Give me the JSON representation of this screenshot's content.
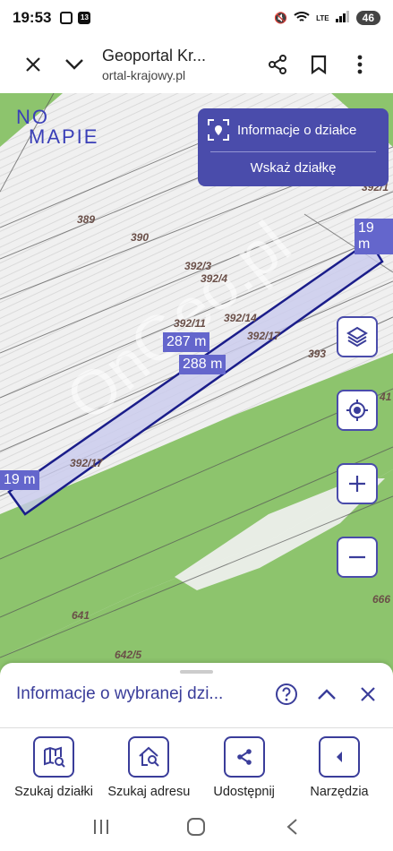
{
  "status": {
    "time": "19:53",
    "badge": "13",
    "network": "LTE",
    "battery": "46"
  },
  "browser": {
    "title": "Geoportal Kr...",
    "url": "ortal-krajowy.pl"
  },
  "map": {
    "logo_top": "NO",
    "logo_bottom": "MAPIE",
    "info_title": "Informacje o działce",
    "info_action": "Wskaż działkę",
    "measurements": [
      "19 m",
      "287 m",
      "288 m",
      "19 m"
    ],
    "parcels": [
      "389",
      "390",
      "392/3",
      "392/4",
      "392/11",
      "392/14",
      "392/17",
      "393",
      "392/17",
      "392/1",
      "641",
      "642/5",
      "666",
      "41"
    ],
    "watermark": "OnGeo.pl",
    "colors": {
      "field": "#8dc46d",
      "parcel_fill": "#cdcff0",
      "parcel_stroke": "#1a1d8a",
      "accent": "#4a4cab"
    }
  },
  "sheet": {
    "title": "Informacje o wybranej dzi..."
  },
  "actions": [
    {
      "label": "Szukaj działki"
    },
    {
      "label": "Szukaj adresu"
    },
    {
      "label": "Udostępnij"
    },
    {
      "label": "Narzędzia"
    }
  ]
}
